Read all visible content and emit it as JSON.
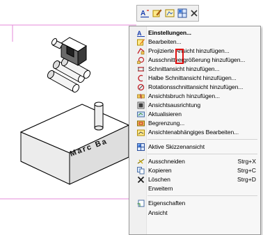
{
  "toolbar": {
    "items": [
      {
        "icon": "dimension-icon"
      },
      {
        "icon": "edit-drawing-icon"
      },
      {
        "icon": "view-icon"
      },
      {
        "icon": "grid-icon"
      },
      {
        "icon": "close-icon"
      }
    ]
  },
  "model": {
    "engraving": "Marc Ba"
  },
  "menu": {
    "items": [
      {
        "label": "Einstellungen...",
        "icon": "settings-icon",
        "bold": true
      },
      {
        "label": "Bearbeiten...",
        "icon": "edit-icon"
      },
      {
        "label": "Projizierte Ansicht hinzufügen...",
        "icon": "projected-view-icon"
      },
      {
        "label": "Ausschnittvergrößerung hinzufügen...",
        "icon": "detail-view-icon"
      },
      {
        "label": "Schnittansicht hinzufügen...",
        "icon": "section-view-icon"
      },
      {
        "label": "Halbe Schnittansicht hinzufügen...",
        "icon": "half-section-icon"
      },
      {
        "label": "Rotationsschnittansicht hinzufügen...",
        "icon": "revolved-section-icon"
      },
      {
        "label": "Ansichtsbruch hinzufügen...",
        "icon": "broken-view-icon"
      },
      {
        "label": "Ansichtsausrichtung",
        "icon": "view-alignment-icon"
      },
      {
        "label": "Aktualisieren",
        "icon": "refresh-icon"
      },
      {
        "label": "Begrenzung...",
        "icon": "boundary-icon"
      },
      {
        "label": "Ansichtenabhängiges Bearbeiten...",
        "icon": "view-dependent-edit-icon"
      },
      {
        "label": "Aktive Skizzenansicht",
        "icon": "sketch-view-icon"
      },
      {
        "label": "Ausschneiden",
        "icon": "cut-icon",
        "shortcut": "Strg+X"
      },
      {
        "label": "Kopieren",
        "icon": "copy-icon",
        "shortcut": "Strg+C"
      },
      {
        "label": "Löschen",
        "icon": "delete-icon",
        "shortcut": "Strg+D"
      },
      {
        "label": "Erweitern",
        "icon": ""
      },
      {
        "label": "Eigenschaften",
        "icon": "properties-icon"
      },
      {
        "label": "Ansicht",
        "icon": ""
      }
    ]
  }
}
